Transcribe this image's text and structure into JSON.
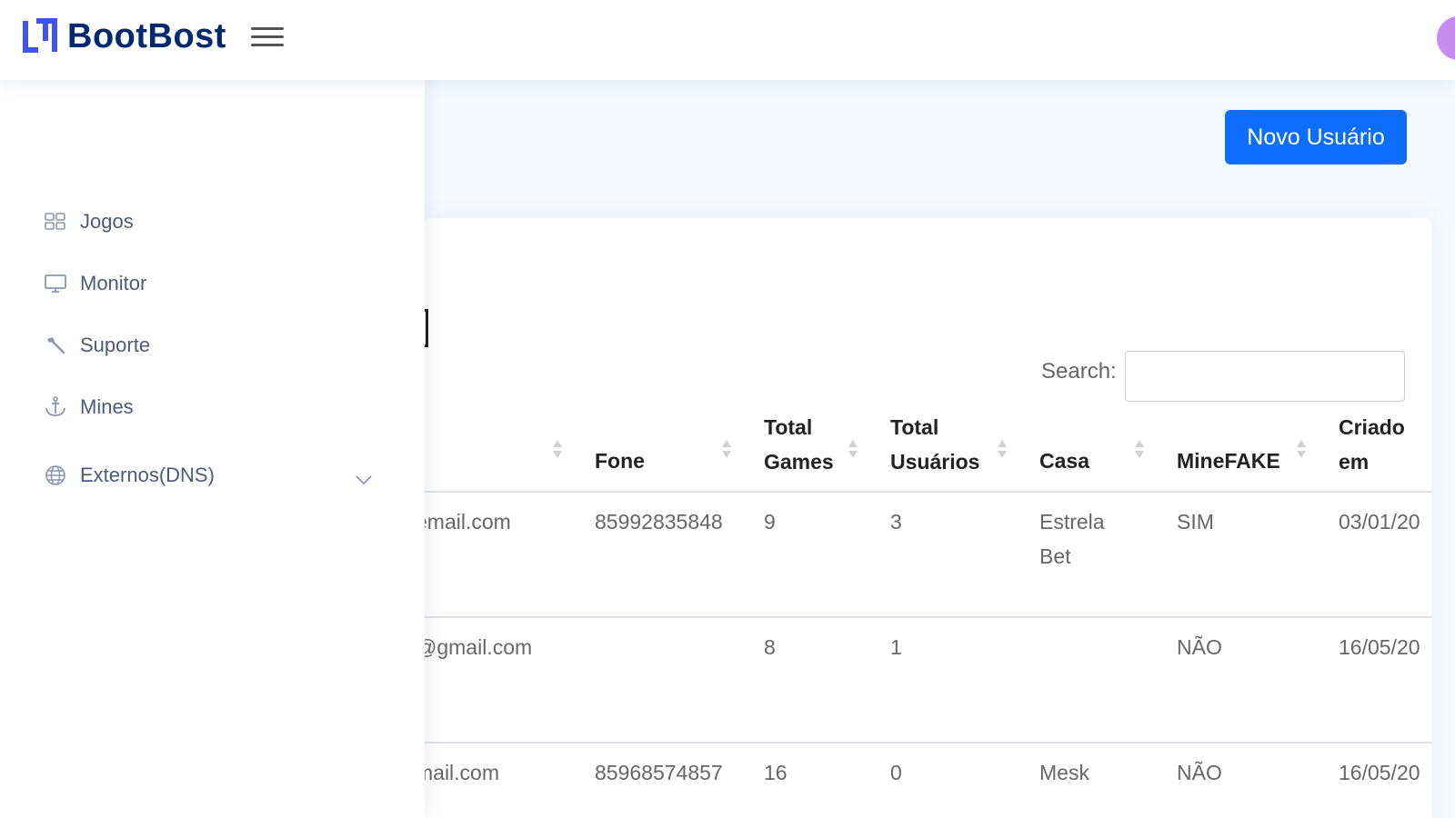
{
  "brand": {
    "name": "BootBost"
  },
  "sidebar": {
    "items": [
      {
        "label": "Jogos",
        "icon": "grid-icon"
      },
      {
        "label": "Monitor",
        "icon": "monitor-icon"
      },
      {
        "label": "Suporte",
        "icon": "tools-icon"
      },
      {
        "label": "Mines",
        "icon": "anchor-icon"
      },
      {
        "label": "Externos(DNS)",
        "icon": "globe-icon"
      }
    ]
  },
  "toolbar": {
    "new_user_label": "Novo Usuário"
  },
  "search": {
    "label": "Search:",
    "value": ""
  },
  "table": {
    "headers": {
      "fone": "Fone",
      "total_games_1": "Total",
      "total_games_2": "Games",
      "total_users_1": "Total",
      "total_users_2": "Usuários",
      "casa": "Casa",
      "minefake": "MineFAKE",
      "criado_1": "Criado",
      "criado_2": "em"
    },
    "rows": [
      {
        "email": "email.com",
        "fone": "85992835848",
        "games": "9",
        "users": "3",
        "casa_1": "Estrela",
        "casa_2": "Bet",
        "minefake": "SIM",
        "criado": "03/01/20"
      },
      {
        "email": "@gmail.com",
        "fone": "",
        "games": "8",
        "users": "1",
        "casa_1": "",
        "casa_2": "",
        "minefake": "NÃO",
        "criado": "16/05/20"
      },
      {
        "email": "mail.com",
        "fone": "85968574857",
        "games": "16",
        "users": "0",
        "casa_1": "Mesk",
        "casa_2": "",
        "minefake": "NÃO",
        "criado": "16/05/20"
      }
    ]
  },
  "colors": {
    "primary": "#0d6efd",
    "brand": "#012970",
    "logo_accent": "#4154f1"
  }
}
